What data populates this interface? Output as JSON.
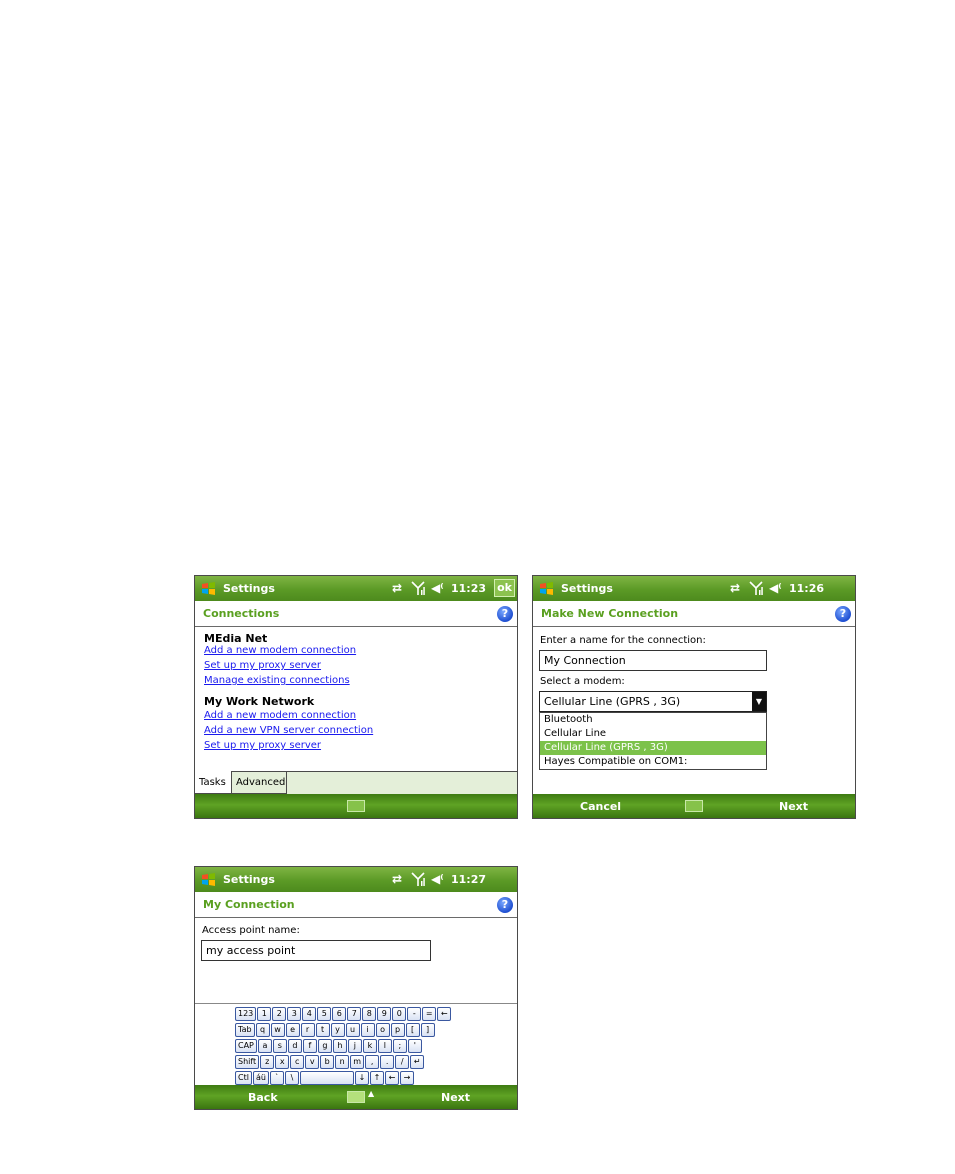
{
  "common": {
    "app_title": "Settings",
    "sync_icon": "sync-arrows-icon",
    "signal_icon": "signal-icon",
    "volume_icon": "volume-icon",
    "help_label": "?",
    "keyboard_icon": "keyboard-icon",
    "windows_logo": "windows-flag-icon",
    "colors": {
      "accent": "#5aa020",
      "link": "#1a1aee",
      "selection": "#7cc24a"
    }
  },
  "screen1": {
    "time": "11:23",
    "ok_label": "ok",
    "page_title": "Connections",
    "groups": [
      {
        "name": "MEdia Net",
        "links": [
          "Add a new modem connection",
          "Set up my proxy server",
          "Manage existing connections"
        ]
      },
      {
        "name": "My Work Network",
        "links": [
          "Add a new modem connection",
          "Add a new VPN server connection",
          "Set up my proxy server"
        ]
      }
    ],
    "tabs": [
      "Tasks",
      "Advanced"
    ]
  },
  "screen2": {
    "time": "11:26",
    "page_title": "Make New Connection",
    "name_label": "Enter a name for the connection:",
    "name_value": "My Connection",
    "modem_label": "Select a modem:",
    "modem_selected": "Cellular Line (GPRS , 3G)",
    "modem_options": [
      "Bluetooth",
      "Cellular Line",
      "Cellular Line (GPRS , 3G)",
      "Hayes Compatible on COM1:"
    ],
    "left_softkey": "Cancel",
    "right_softkey": "Next"
  },
  "screen3": {
    "time": "11:27",
    "page_title": "My Connection",
    "apn_label": "Access point name:",
    "apn_value": "my access point",
    "keyboard_rows": [
      [
        "123",
        "1",
        "2",
        "3",
        "4",
        "5",
        "6",
        "7",
        "8",
        "9",
        "0",
        "-",
        "=",
        "←"
      ],
      [
        "Tab",
        "q",
        "w",
        "e",
        "r",
        "t",
        "y",
        "u",
        "i",
        "o",
        "p",
        "[",
        "]"
      ],
      [
        "CAP",
        "a",
        "s",
        "d",
        "f",
        "g",
        "h",
        "j",
        "k",
        "l",
        ";",
        "'"
      ],
      [
        "Shift",
        "z",
        "x",
        "c",
        "v",
        "b",
        "n",
        "m",
        ",",
        ".",
        "/",
        "↵"
      ],
      [
        "Ctl",
        "áü",
        "`",
        "\\",
        "",
        "↓",
        "↑",
        "←",
        "→"
      ]
    ],
    "left_softkey": "Back",
    "right_softkey": "Next"
  }
}
